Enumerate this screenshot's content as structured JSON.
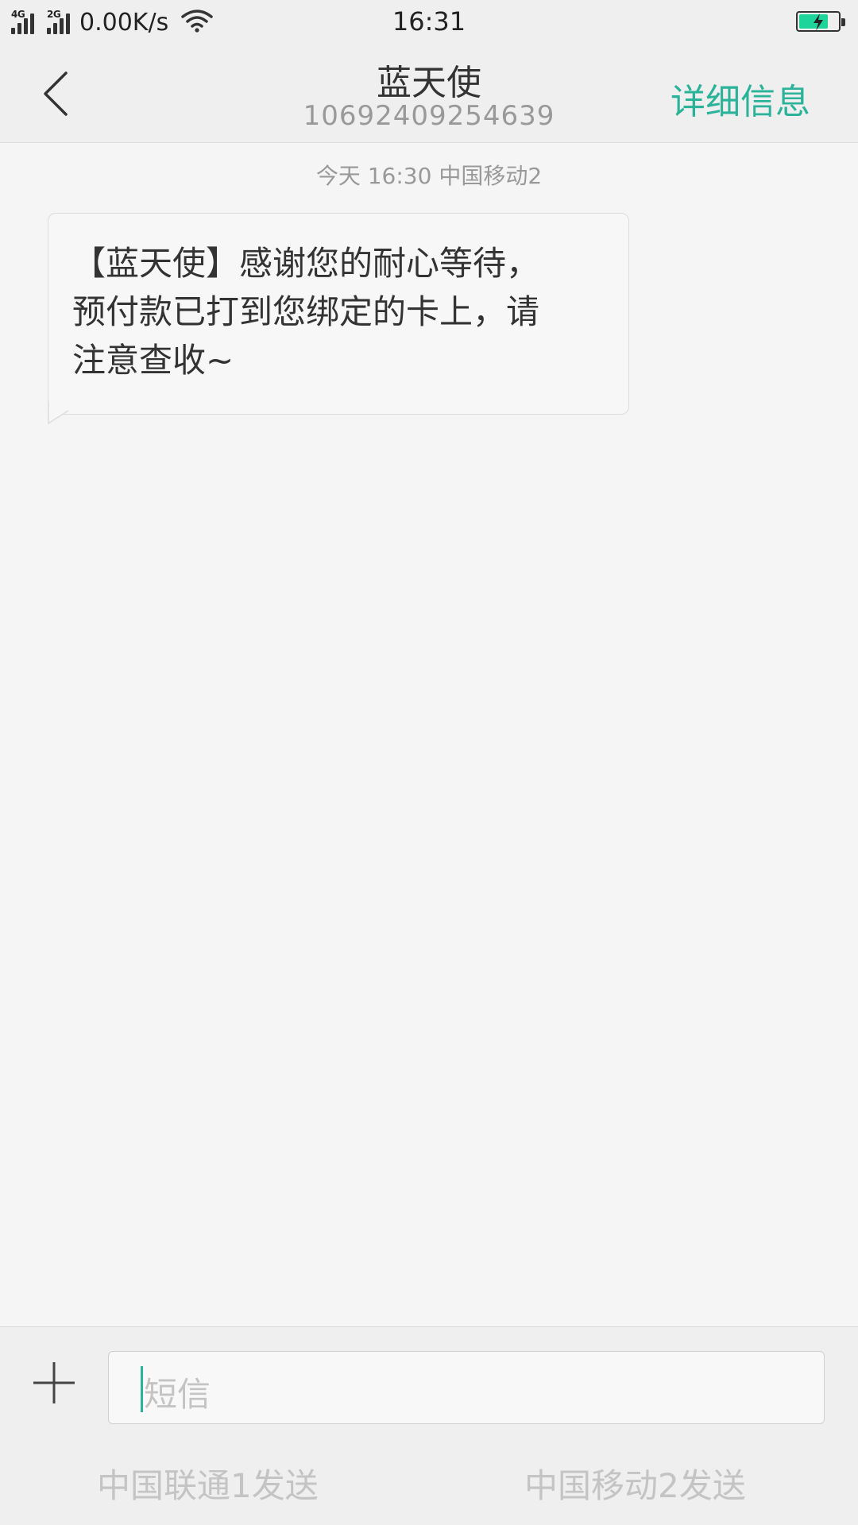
{
  "status_bar": {
    "network_1": "4G",
    "network_2": "2G",
    "speed": "0.00K/s",
    "time": "16:31",
    "battery_icon": "battery-charging-icon",
    "battery_color": "#1ed49a"
  },
  "header": {
    "back_icon": "chevron-left-icon",
    "contact_name": "蓝天使",
    "contact_number": "10692409254639",
    "details_label": "详细信息",
    "accent_color": "#2bb39a"
  },
  "conversation": {
    "timestamp": "今天  16:30  中国移动2",
    "messages": [
      {
        "direction": "incoming",
        "lines": [
          "【蓝天使】感谢您的耐心等待，",
          "预付款已打到您绑定的卡上，请",
          "注意查收~"
        ]
      }
    ]
  },
  "composer": {
    "attach_icon": "plus-icon",
    "input_placeholder": "短信",
    "input_value": "",
    "send_sim1_label": "中国联通1发送",
    "send_sim2_label": "中国移动2发送"
  }
}
